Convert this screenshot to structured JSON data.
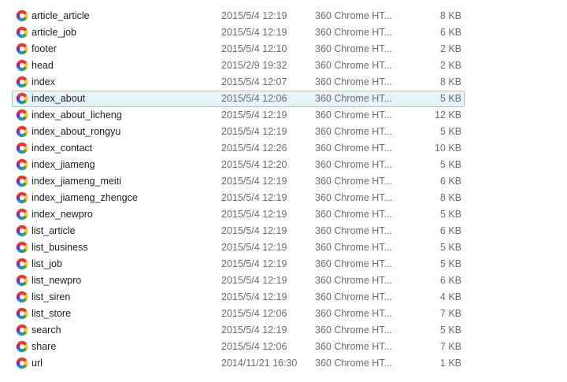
{
  "files": [
    {
      "name": "article_article",
      "date": "2015/5/4 12:19",
      "type": "360 Chrome HT...",
      "size": "8 KB",
      "icon": "browser-html-file-icon"
    },
    {
      "name": "article_job",
      "date": "2015/5/4 12:19",
      "type": "360 Chrome HT...",
      "size": "6 KB",
      "icon": "browser-html-file-icon"
    },
    {
      "name": "footer",
      "date": "2015/5/4 12:10",
      "type": "360 Chrome HT...",
      "size": "2 KB",
      "icon": "browser-html-file-icon"
    },
    {
      "name": "head",
      "date": "2015/2/9 19:32",
      "type": "360 Chrome HT...",
      "size": "2 KB",
      "icon": "browser-html-file-icon"
    },
    {
      "name": "index",
      "date": "2015/5/4 12:07",
      "type": "360 Chrome HT...",
      "size": "8 KB",
      "icon": "browser-html-file-icon"
    },
    {
      "name": "index_about",
      "date": "2015/5/4 12:06",
      "type": "360 Chrome HT...",
      "size": "5 KB",
      "icon": "browser-html-file-icon",
      "selected": true
    },
    {
      "name": "index_about_licheng",
      "date": "2015/5/4 12:19",
      "type": "360 Chrome HT...",
      "size": "12 KB",
      "icon": "browser-html-file-icon"
    },
    {
      "name": "index_about_rongyu",
      "date": "2015/5/4 12:19",
      "type": "360 Chrome HT...",
      "size": "5 KB",
      "icon": "browser-html-file-icon"
    },
    {
      "name": "index_contact",
      "date": "2015/5/4 12:26",
      "type": "360 Chrome HT...",
      "size": "10 KB",
      "icon": "browser-html-file-icon"
    },
    {
      "name": "index_jiameng",
      "date": "2015/5/4 12:20",
      "type": "360 Chrome HT...",
      "size": "5 KB",
      "icon": "browser-html-file-icon"
    },
    {
      "name": "index_jiameng_meiti",
      "date": "2015/5/4 12:19",
      "type": "360 Chrome HT...",
      "size": "6 KB",
      "icon": "browser-html-file-icon"
    },
    {
      "name": "index_jiameng_zhengce",
      "date": "2015/5/4 12:19",
      "type": "360 Chrome HT...",
      "size": "8 KB",
      "icon": "browser-html-file-icon"
    },
    {
      "name": "index_newpro",
      "date": "2015/5/4 12:19",
      "type": "360 Chrome HT...",
      "size": "5 KB",
      "icon": "browser-html-file-icon"
    },
    {
      "name": "list_article",
      "date": "2015/5/4 12:19",
      "type": "360 Chrome HT...",
      "size": "6 KB",
      "icon": "browser-html-file-icon"
    },
    {
      "name": "list_business",
      "date": "2015/5/4 12:19",
      "type": "360 Chrome HT...",
      "size": "5 KB",
      "icon": "browser-html-file-icon"
    },
    {
      "name": "list_job",
      "date": "2015/5/4 12:19",
      "type": "360 Chrome HT...",
      "size": "5 KB",
      "icon": "browser-html-file-icon"
    },
    {
      "name": "list_newpro",
      "date": "2015/5/4 12:19",
      "type": "360 Chrome HT...",
      "size": "6 KB",
      "icon": "browser-html-file-icon"
    },
    {
      "name": "list_siren",
      "date": "2015/5/4 12:19",
      "type": "360 Chrome HT...",
      "size": "4 KB",
      "icon": "browser-html-file-icon"
    },
    {
      "name": "list_store",
      "date": "2015/5/4 12:06",
      "type": "360 Chrome HT...",
      "size": "7 KB",
      "icon": "browser-html-file-icon"
    },
    {
      "name": "search",
      "date": "2015/5/4 12:19",
      "type": "360 Chrome HT...",
      "size": "5 KB",
      "icon": "browser-html-file-icon"
    },
    {
      "name": "share",
      "date": "2015/5/4 12:06",
      "type": "360 Chrome HT...",
      "size": "7 KB",
      "icon": "browser-html-file-icon"
    },
    {
      "name": "url",
      "date": "2014/11/21 16:30",
      "type": "360 Chrome HT...",
      "size": "1 KB",
      "icon": "browser-html-file-icon"
    }
  ],
  "colors": {
    "selection_background": "#e5f3fb",
    "selection_border": "#99c9ef",
    "name_text": "#1e1e1e",
    "meta_text": "#6d6d6d"
  }
}
